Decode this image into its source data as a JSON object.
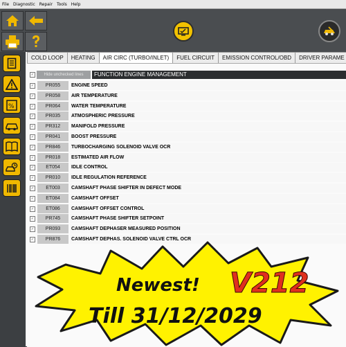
{
  "menu": [
    "File",
    "Diagnostic",
    "Repair",
    "Tools",
    "Help"
  ],
  "tabs": [
    {
      "label": "COLD LOOP",
      "active": false
    },
    {
      "label": "HEATING",
      "active": false
    },
    {
      "label": "AIR CIRC  (TURBO/INLET)",
      "active": true
    },
    {
      "label": "FUEL CIRCUIT",
      "active": false
    },
    {
      "label": "EMISSION CONTROL/OBD",
      "active": false
    },
    {
      "label": "DRIVER PARAME",
      "active": false
    }
  ],
  "header": {
    "hide_label": "Hide unchecked lines",
    "function_label": "FUNCTION ENGINE MANAGEMENT"
  },
  "rows": [
    {
      "code": "PR055",
      "desc": "ENGINE SPEED"
    },
    {
      "code": "PR058",
      "desc": "AIR TEMPERATURE"
    },
    {
      "code": "PR064",
      "desc": "WATER TEMPERATURE"
    },
    {
      "code": "PR035",
      "desc": "ATMOSPHERIC PRESSURE"
    },
    {
      "code": "PR312",
      "desc": "MANIFOLD PRESSURE"
    },
    {
      "code": "PR041",
      "desc": "BOOST PRESSURE"
    },
    {
      "code": "PR846",
      "desc": "TURBOCHARGING SOLENOID VALVE OCR"
    },
    {
      "code": "PR018",
      "desc": "ESTIMATED AIR FLOW"
    },
    {
      "code": "ET054",
      "desc": "IDLE CONTROL"
    },
    {
      "code": "PR010",
      "desc": "IDLE REGULATION REFERENCE"
    },
    {
      "code": "ET003",
      "desc": "CAMSHAFT PHASE SHIFTER IN DEFECT MODE"
    },
    {
      "code": "ET084",
      "desc": "CAMSHAFT OFFSET"
    },
    {
      "code": "ET086",
      "desc": "CAMSHAFT OFFSET CONTROL"
    },
    {
      "code": "PR745",
      "desc": "CAMSHAFT PHASE SHIFTER SETPOINT"
    },
    {
      "code": "PR093",
      "desc": "CAMSHAFT DEPHASER MEASURED POSITION"
    },
    {
      "code": "PR876",
      "desc": "CAMSHAFT DEPHAS. SOLENOID VALVE CTRL OCR"
    }
  ],
  "banner": {
    "line1": "Newest!",
    "version": "V212",
    "line2": "Till 31/12/2029"
  },
  "colors": {
    "accent_yellow": "#f0b800",
    "banner_yellow": "#fff200",
    "version_red": "#e0301e"
  },
  "icons": {
    "toolbar": [
      "home-icon",
      "back-arrow-icon",
      "printer-icon",
      "help-icon",
      "diagnostic-screen-icon",
      "vehicle-tool-icon"
    ],
    "sidebar": [
      "document-icon",
      "warning-icon",
      "percent-icon",
      "car-icon",
      "book-icon",
      "car-sync-icon",
      "barcode-icon"
    ]
  }
}
